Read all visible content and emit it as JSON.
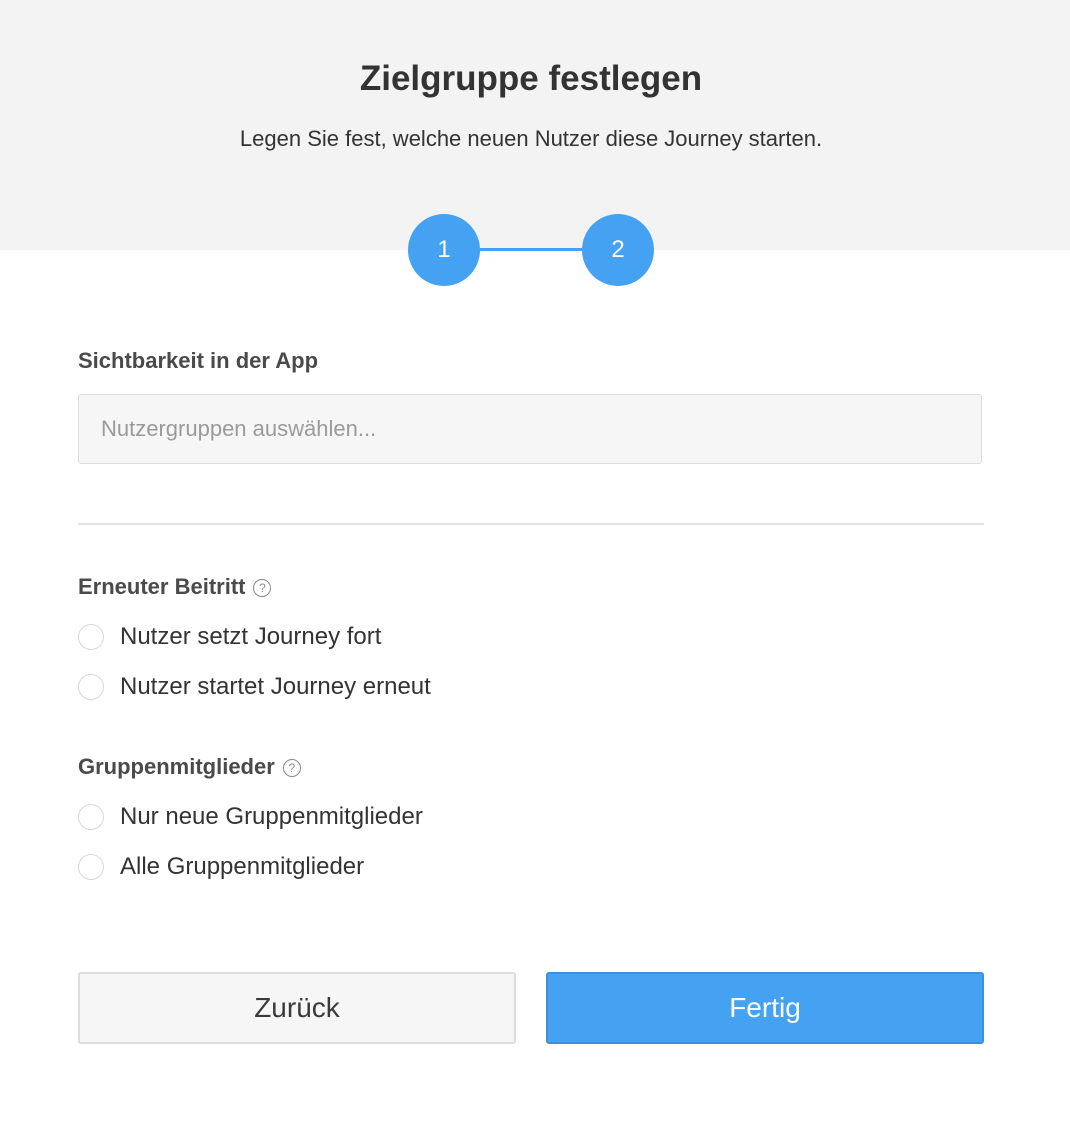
{
  "header": {
    "title": "Zielgruppe festlegen",
    "subtitle": "Legen Sie fest, welche neuen Nutzer diese Journey starten."
  },
  "stepper": {
    "steps": [
      "1",
      "2"
    ],
    "active_step": 2,
    "accent_color": "#45a2f2"
  },
  "visibility": {
    "label": "Sichtbarkeit in der App",
    "placeholder": "Nutzergruppen auswählen...",
    "value": ""
  },
  "rejoin": {
    "label": "Erneuter Beitritt",
    "help_icon": "question-circle-icon",
    "help_glyph": "?",
    "options": [
      {
        "label": "Nutzer setzt Journey fort",
        "selected": false
      },
      {
        "label": "Nutzer startet Journey erneut",
        "selected": false
      }
    ]
  },
  "members": {
    "label": "Gruppenmitglieder",
    "help_icon": "question-circle-icon",
    "help_glyph": "?",
    "options": [
      {
        "label": "Nur neue Gruppenmitglieder",
        "selected": false
      },
      {
        "label": "Alle Gruppenmitglieder",
        "selected": false
      }
    ]
  },
  "buttons": {
    "back_label": "Zurück",
    "done_label": "Fertig"
  }
}
